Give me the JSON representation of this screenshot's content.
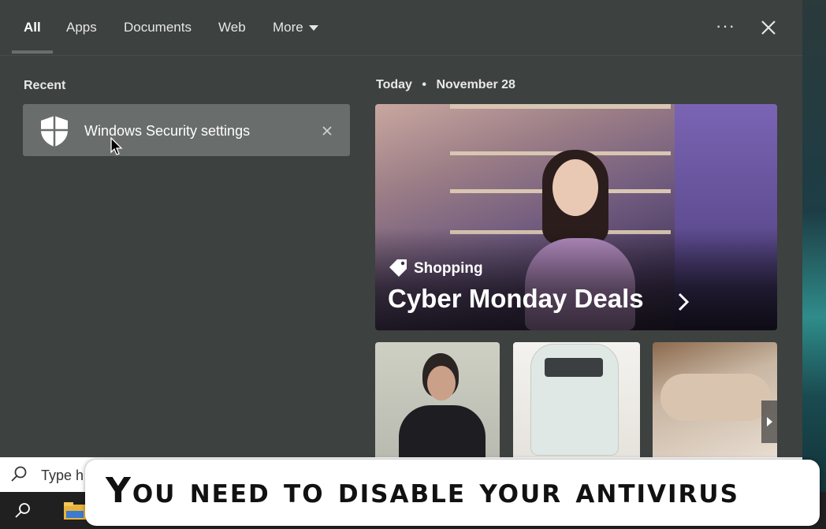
{
  "tabs": [
    {
      "label": "All",
      "active": true
    },
    {
      "label": "Apps"
    },
    {
      "label": "Documents"
    },
    {
      "label": "Web"
    },
    {
      "label": "More"
    }
  ],
  "toolbar": {
    "more_options_icon": "ellipsis-icon",
    "close_icon": "close-icon"
  },
  "recent": {
    "heading": "Recent",
    "items": [
      {
        "label": "Windows Security settings",
        "icon": "shield-icon"
      }
    ]
  },
  "today": {
    "heading": "Today",
    "separator": "•",
    "date": "November 28",
    "hero": {
      "category": "Shopping",
      "headline": "Cyber Monday Deals"
    }
  },
  "search": {
    "placeholder": "Type here to search",
    "value": "Type h"
  },
  "caption": {
    "text": "You need to disable your antivirus"
  },
  "colors": {
    "panel": "#3d413f",
    "recent_item": "#696d6b",
    "accent": "#ffffff"
  }
}
